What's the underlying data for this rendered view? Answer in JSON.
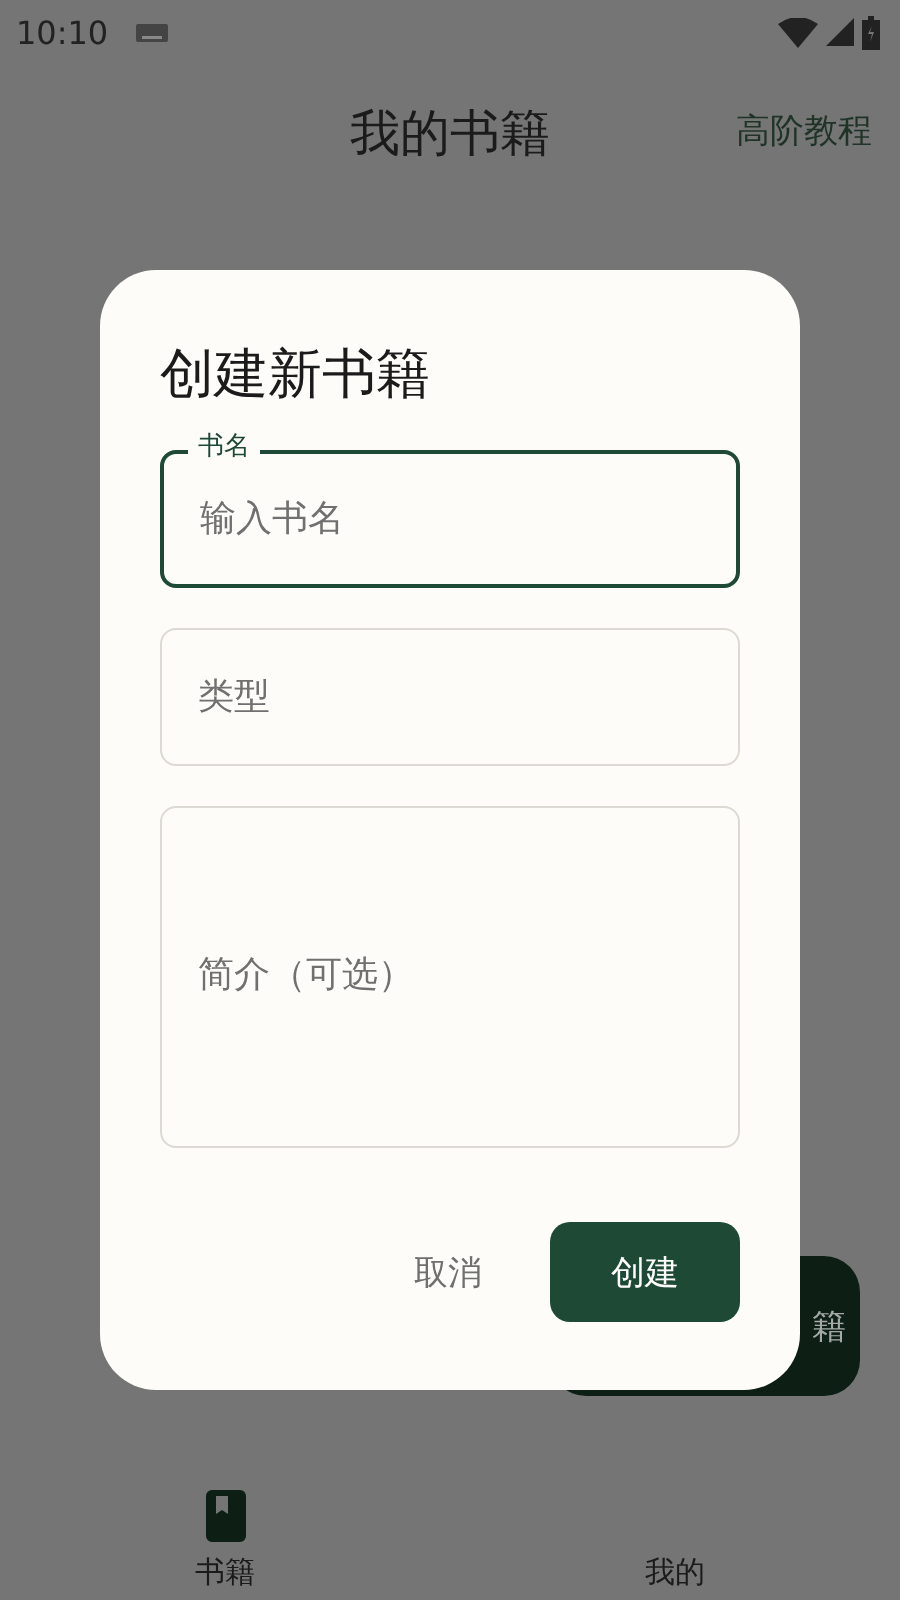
{
  "status_bar": {
    "time": "10:10"
  },
  "app_bar": {
    "title": "我的书籍",
    "action": "高阶教程"
  },
  "fab": {
    "label": "籍"
  },
  "bottom_nav": [
    {
      "label": "书籍",
      "kind": "book"
    },
    {
      "label": "我的",
      "kind": "hidden"
    }
  ],
  "dialog": {
    "title": "创建新书籍",
    "fields": [
      {
        "kind": "text",
        "label": "书名",
        "placeholder": "输入书名",
        "focused": true
      },
      {
        "kind": "text",
        "placeholder": "类型",
        "focused": false
      },
      {
        "kind": "multiline",
        "placeholder": "简介（可选）",
        "focused": false
      }
    ],
    "buttons": [
      {
        "label": "取消",
        "kind": "text"
      },
      {
        "label": "创建",
        "kind": "filled"
      }
    ]
  }
}
